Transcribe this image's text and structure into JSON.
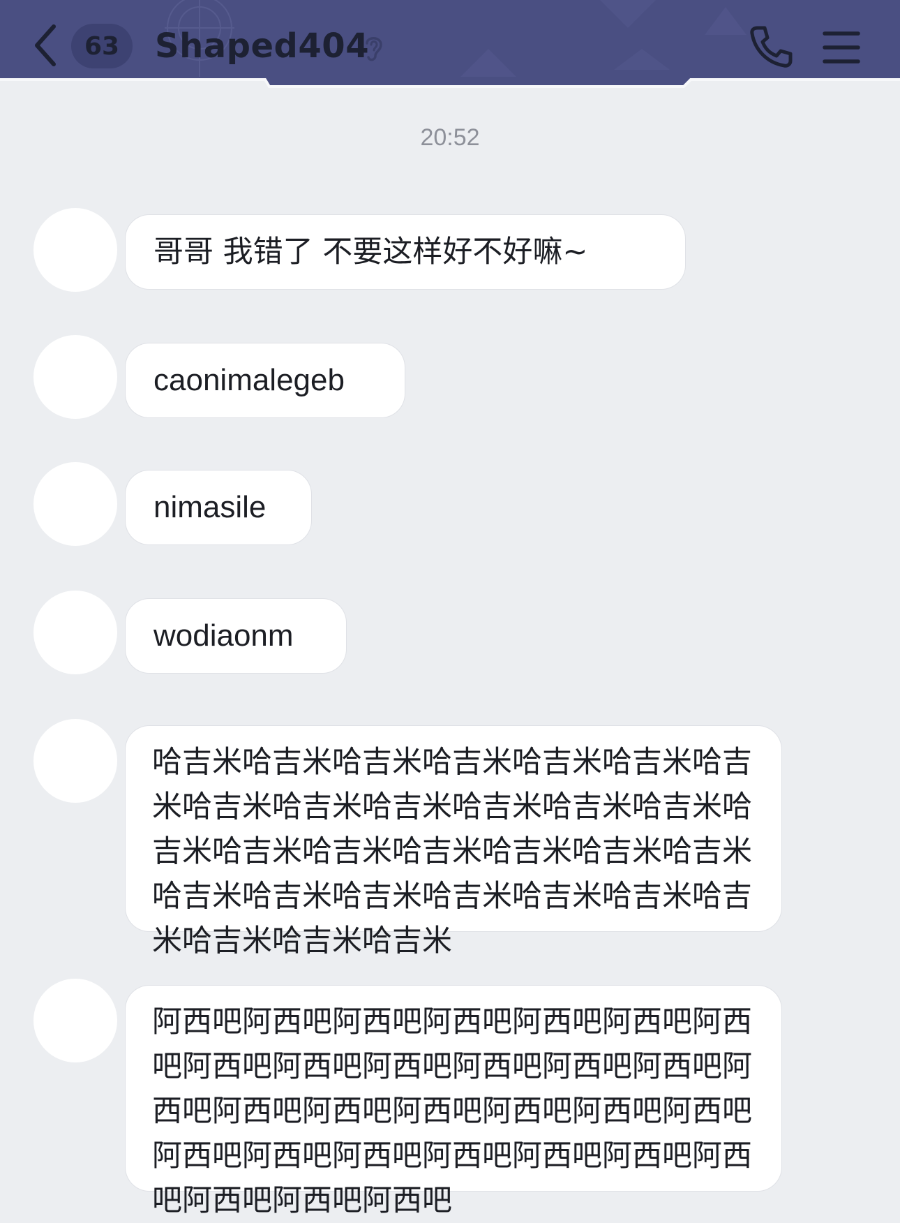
{
  "header": {
    "back_icon": "chevron-left-icon",
    "unread_count": "63",
    "contact_name": "Shaped404",
    "ear_icon": "ear-icon",
    "call_icon": "phone-icon",
    "menu_icon": "menu-icon",
    "background_color": "#4a4f82"
  },
  "chat": {
    "timestamp": "20:52",
    "messages": [
      {
        "text": "哥哥 我错了 不要这样好不好嘛~"
      },
      {
        "text": "caonimalegeb"
      },
      {
        "text": "nimasile"
      },
      {
        "text": "wodiaonm"
      },
      {
        "text": "哈吉米哈吉米哈吉米哈吉米哈吉米哈吉米哈吉米哈吉米哈吉米哈吉米哈吉米哈吉米哈吉米哈吉米哈吉米哈吉米哈吉米哈吉米哈吉米哈吉米哈吉米哈吉米哈吉米哈吉米哈吉米哈吉米哈吉米哈吉米哈吉米哈吉米"
      },
      {
        "text": "阿西吧阿西吧阿西吧阿西吧阿西吧阿西吧阿西吧阿西吧阿西吧阿西吧阿西吧阿西吧阿西吧阿西吧阿西吧阿西吧阿西吧阿西吧阿西吧阿西吧阿西吧阿西吧阿西吧阿西吧阿西吧阿西吧阿西吧阿西吧阿西吧阿西吧"
      }
    ]
  }
}
